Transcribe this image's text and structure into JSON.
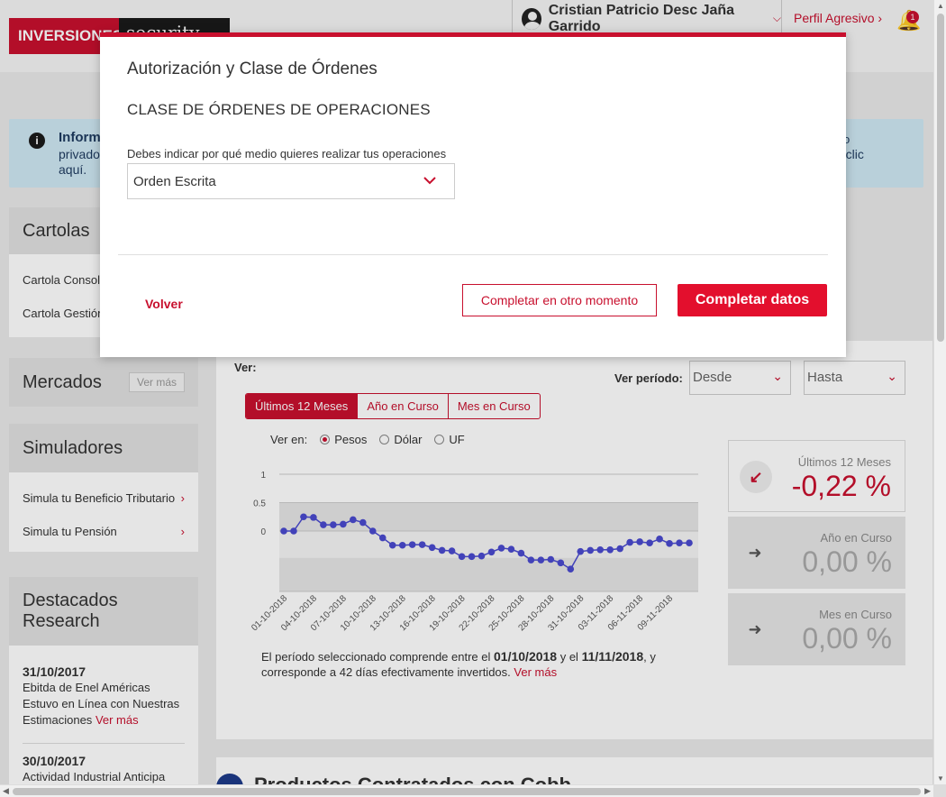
{
  "header": {
    "logo_part1": "INVERSIONES",
    "logo_part2": "security",
    "user_name": "Cristian Patricio Desc Jaña Garrido",
    "profile_link": "Perfil Agresivo",
    "notification_count": "1"
  },
  "info_banner": {
    "title": "Informa",
    "line2": "privado",
    "line3": "aquí.",
    "right1": "o",
    "right2": "a clic"
  },
  "sidebar": {
    "cartolas": {
      "title": "Cartolas",
      "items": [
        "Cartola Consol",
        "Cartola Gestión"
      ]
    },
    "mercados": {
      "title": "Mercados",
      "ver_mas": "Ver más"
    },
    "simuladores": {
      "title": "Simuladores",
      "items": [
        "Simula tu Beneficio Tributario",
        "Simula tu Pensión"
      ]
    },
    "research": {
      "title_line1": "Destacados",
      "title_line2": "Research",
      "items": [
        {
          "date": "31/10/2017",
          "text": "Ebitda de Enel Américas Estuvo en Línea con Nuestras Estimaciones",
          "link": "Ver más"
        },
        {
          "date": "30/10/2017",
          "text": "Actividad Industrial Anticipa"
        }
      ]
    }
  },
  "main": {
    "ver_label": "Ver:",
    "periodo_label": "Ver período:",
    "desde": "Desde",
    "hasta": "Hasta",
    "tabs": [
      "Últimos 12 Meses",
      "Año en Curso",
      "Mes en Curso"
    ],
    "ver_en_label": "Ver en:",
    "currencies": [
      "Pesos",
      "Dólar",
      "UF"
    ],
    "period_text_1": "El período seleccionado comprende entre el",
    "period_start": "01/10/2018",
    "period_and": "y el",
    "period_end": "11/11/2018",
    "period_text_2": ", y corresponde a 42 días efectivamente invertidos.",
    "period_link": "Ver más",
    "stats": [
      {
        "label": "Últimos 12 Meses",
        "value": "-0,22 %"
      },
      {
        "label": "Año en Curso",
        "value": "0,00 %"
      },
      {
        "label": "Mes en Curso",
        "value": "0,00 %"
      }
    ],
    "products_title": "Productos Contratados con Cobb"
  },
  "modal": {
    "title": "Autorización y Clase de Órdenes",
    "subtitle": "CLASE DE ÓRDENES DE OPERACIONES",
    "field_label": "Debes indicar por qué medio quieres realizar tus operaciones",
    "field_value": "Orden Escrita",
    "back_label": "Volver",
    "later_label": "Completar en otro momento",
    "complete_label": "Completar datos"
  },
  "chart_data": {
    "type": "line",
    "y_ticks": [
      "1",
      "0.5",
      "0"
    ],
    "ylim": [
      -1,
      1
    ],
    "x_tick_labels": [
      "01-10-2018",
      "04-10-2018",
      "07-10-2018",
      "10-10-2018",
      "13-10-2018",
      "16-10-2018",
      "19-10-2018",
      "22-10-2018",
      "25-10-2018",
      "28-10-2018",
      "31-10-2018",
      "03-11-2018",
      "06-11-2018",
      "09-11-2018"
    ],
    "series": [
      {
        "color": "#4a4acf",
        "values": [
          0.0,
          0.0,
          0.25,
          0.24,
          0.11,
          0.11,
          0.12,
          0.2,
          0.15,
          0.0,
          -0.12,
          -0.25,
          -0.25,
          -0.24,
          -0.24,
          -0.29,
          -0.34,
          -0.35,
          -0.45,
          -0.45,
          -0.44,
          -0.37,
          -0.3,
          -0.32,
          -0.39,
          -0.51,
          -0.51,
          -0.5,
          -0.56,
          -0.67,
          -0.36,
          -0.34,
          -0.33,
          -0.33,
          -0.31,
          -0.2,
          -0.19,
          -0.21,
          -0.14,
          -0.22,
          -0.21,
          -0.21
        ]
      }
    ]
  }
}
